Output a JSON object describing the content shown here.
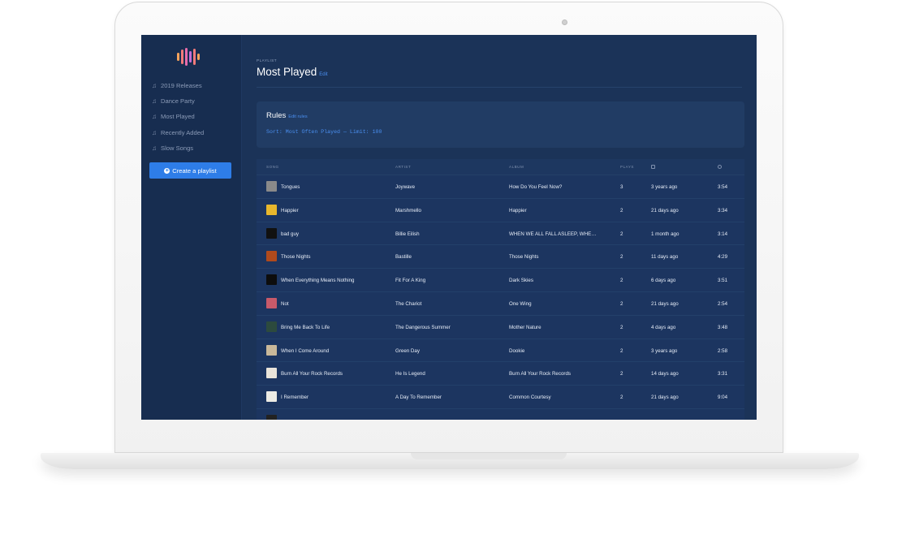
{
  "sidebar": {
    "items": [
      {
        "label": "2019 Releases",
        "icon": "music-note-icon"
      },
      {
        "label": "Dance Party",
        "icon": "music-note-icon"
      },
      {
        "label": "Most Played",
        "icon": "music-note-icon"
      },
      {
        "label": "Recently Added",
        "icon": "music-note-icon"
      },
      {
        "label": "Slow Songs",
        "icon": "music-note-icon"
      }
    ],
    "create_label": "Create a playlist"
  },
  "header": {
    "eyebrow": "PLAYLIST",
    "title": "Most Played",
    "edit": "Edit"
  },
  "rules": {
    "title": "Rules",
    "edit": "Edit rules",
    "text": "Sort: Most Often Played — Limit: 100"
  },
  "table": {
    "headers": {
      "song": "SONG",
      "artist": "ARTIST",
      "album": "ALBUM",
      "plays": "PLAYS"
    },
    "rows": [
      {
        "song": "Tongues",
        "artist": "Joywave",
        "album": "How Do You Feel Now?",
        "plays": "3",
        "added": "3 years ago",
        "duration": "3:54",
        "art": "#8a8a8a"
      },
      {
        "song": "Happier",
        "artist": "Marshmello",
        "album": "Happier",
        "plays": "2",
        "added": "21 days ago",
        "duration": "3:34",
        "art": "#e8b72d"
      },
      {
        "song": "bad guy",
        "artist": "Billie Eilish",
        "album": "WHEN WE ALL FALL ASLEEP, WHERE DO WE GO?",
        "plays": "2",
        "added": "1 month ago",
        "duration": "3:14",
        "art": "#111111"
      },
      {
        "song": "Those Nights",
        "artist": "Bastille",
        "album": "Those Nights",
        "plays": "2",
        "added": "11 days ago",
        "duration": "4:29",
        "art": "#b04a1c"
      },
      {
        "song": "When Everything Means Nothing",
        "artist": "Fit For A King",
        "album": "Dark Skies",
        "plays": "2",
        "added": "6 days ago",
        "duration": "3:51",
        "art": "#0d0d0d"
      },
      {
        "song": "Not",
        "artist": "The Chariot",
        "album": "One Wing",
        "plays": "2",
        "added": "21 days ago",
        "duration": "2:54",
        "art": "#c75a6a"
      },
      {
        "song": "Bring Me Back To Life",
        "artist": "The Dangerous Summer",
        "album": "Mother Nature",
        "plays": "2",
        "added": "4 days ago",
        "duration": "3:48",
        "art": "#2c4a3e"
      },
      {
        "song": "When I Come Around",
        "artist": "Green Day",
        "album": "Dookie",
        "plays": "2",
        "added": "3 years ago",
        "duration": "2:58",
        "art": "#c9b89a"
      },
      {
        "song": "Burn All Your Rock Records",
        "artist": "He Is Legend",
        "album": "Burn All Your Rock Records",
        "plays": "2",
        "added": "14 days ago",
        "duration": "3:31",
        "art": "#e9e4da"
      },
      {
        "song": "I Remember",
        "artist": "A Day To Remember",
        "album": "Common Courtesy",
        "plays": "2",
        "added": "21 days ago",
        "duration": "9:04",
        "art": "#ecebe4"
      },
      {
        "song": "",
        "artist": "",
        "album": "",
        "plays": "",
        "added": "",
        "duration": "",
        "art": "#222222"
      }
    ]
  },
  "colors": {
    "accent": "#2e7de8",
    "link": "#4a8ff0",
    "sidebar_bg": "#172d50",
    "main_bg": "#1b3358",
    "logo": [
      "#f8a35c",
      "#f27a7a",
      "#e86cab",
      "#c56ed6",
      "#f27a7a",
      "#f8a35c"
    ]
  }
}
